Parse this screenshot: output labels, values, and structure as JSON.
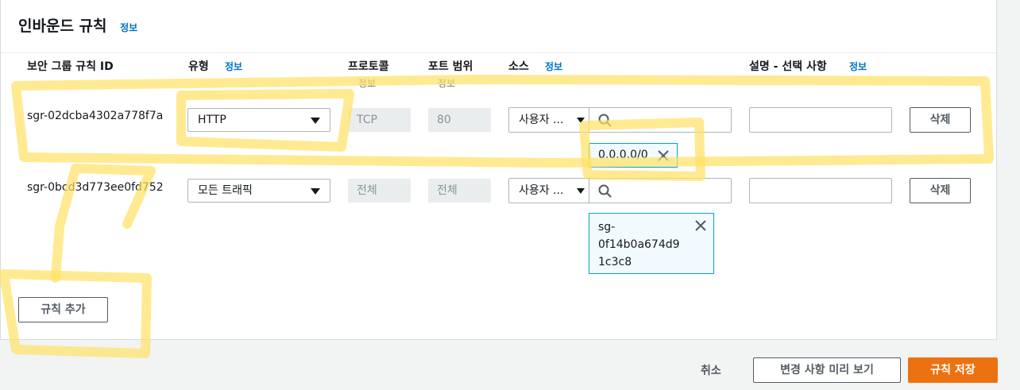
{
  "panel": {
    "title": "인바운드 규칙",
    "info": "정보"
  },
  "columns": {
    "rule_id": "보안 그룹 규칙 ID",
    "type": "유형",
    "type_info": "정보",
    "protocol": "프로토콜",
    "protocol_info": "정보",
    "port_range": "포트 범위",
    "port_info": "정보",
    "source": "소스",
    "source_info": "정보",
    "description": "설명 - 선택 사항",
    "description_info": "정보"
  },
  "rules": [
    {
      "id": "sgr-02dcba4302a778f7a",
      "type": "HTTP",
      "protocol": "TCP",
      "port": "80",
      "source_type": "사용자 ...",
      "search_value": "",
      "token": "0.0.0.0/0",
      "description": "",
      "delete_label": "삭제"
    },
    {
      "id": "sgr-0bcd3d773ee0fd752",
      "type": "모든 트래픽",
      "protocol": "전체",
      "port": "전체",
      "source_type": "사용자 ...",
      "search_value": "",
      "token_lines": [
        "sg-",
        "0f14b0a674d9",
        "1c3c8"
      ],
      "description": "",
      "delete_label": "삭제"
    }
  ],
  "add_rule_label": "규칙 추가",
  "footer": {
    "cancel": "취소",
    "preview": "변경 사항 미리 보기",
    "save": "규칙 저장"
  },
  "colors": {
    "accent": "#ec7211",
    "link": "#0073bb",
    "token_border": "#00a1c9",
    "highlighter": "#ffe164"
  }
}
